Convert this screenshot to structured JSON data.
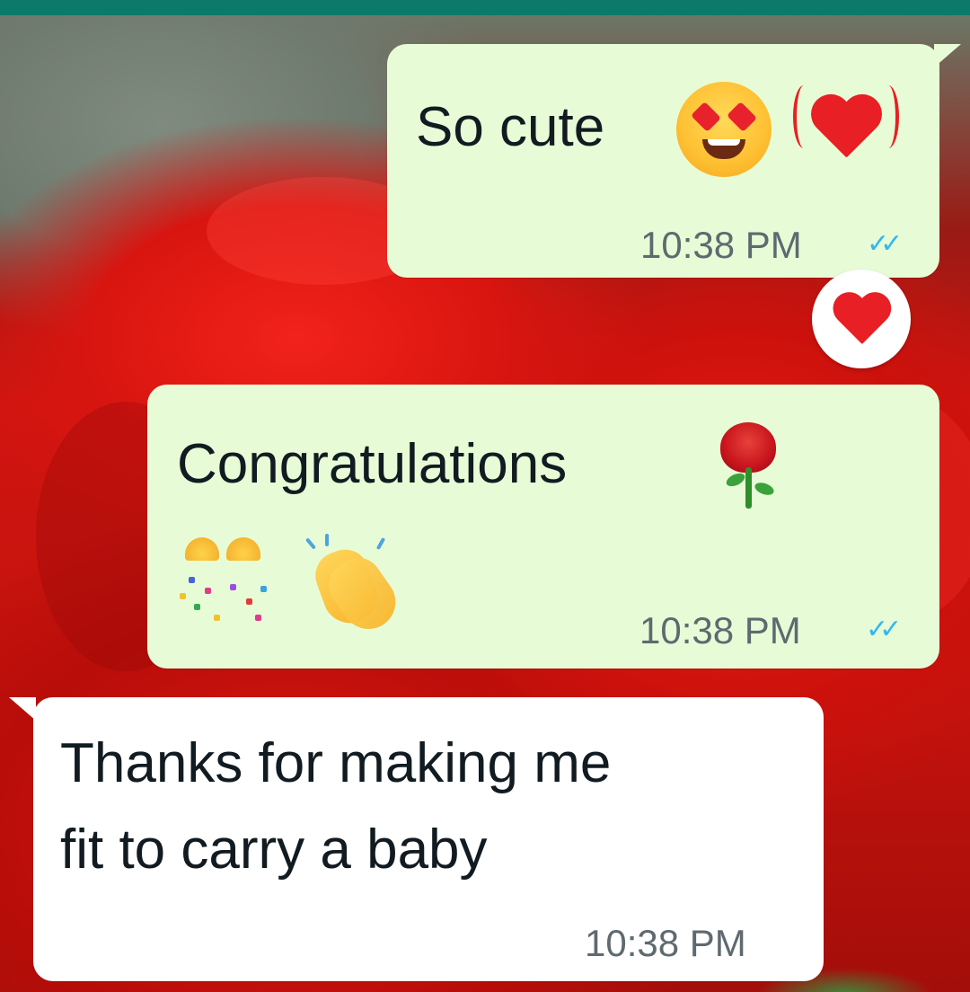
{
  "chat": {
    "messages": [
      {
        "direction": "outgoing",
        "text": "So cute",
        "emojis": [
          "smiling-face-with-heart-eyes",
          "beating-heart"
        ],
        "time": "10:38 PM",
        "read_ticks": "✓✓",
        "reaction": "red-heart"
      },
      {
        "direction": "outgoing",
        "text": "Congratulations",
        "emojis": [
          "rose",
          "confetti-ball",
          "clapping-hands"
        ],
        "time": "10:38 PM",
        "read_ticks": "✓✓"
      },
      {
        "direction": "incoming",
        "text_line1": "Thanks for making me",
        "text_line2": "fit to carry a baby",
        "time": "10:38 PM"
      }
    ]
  },
  "colors": {
    "outgoing_bubble": "#e7fcd6",
    "incoming_bubble": "#ffffff",
    "read_tick": "#34b7f1",
    "header": "#0b7a6a"
  }
}
